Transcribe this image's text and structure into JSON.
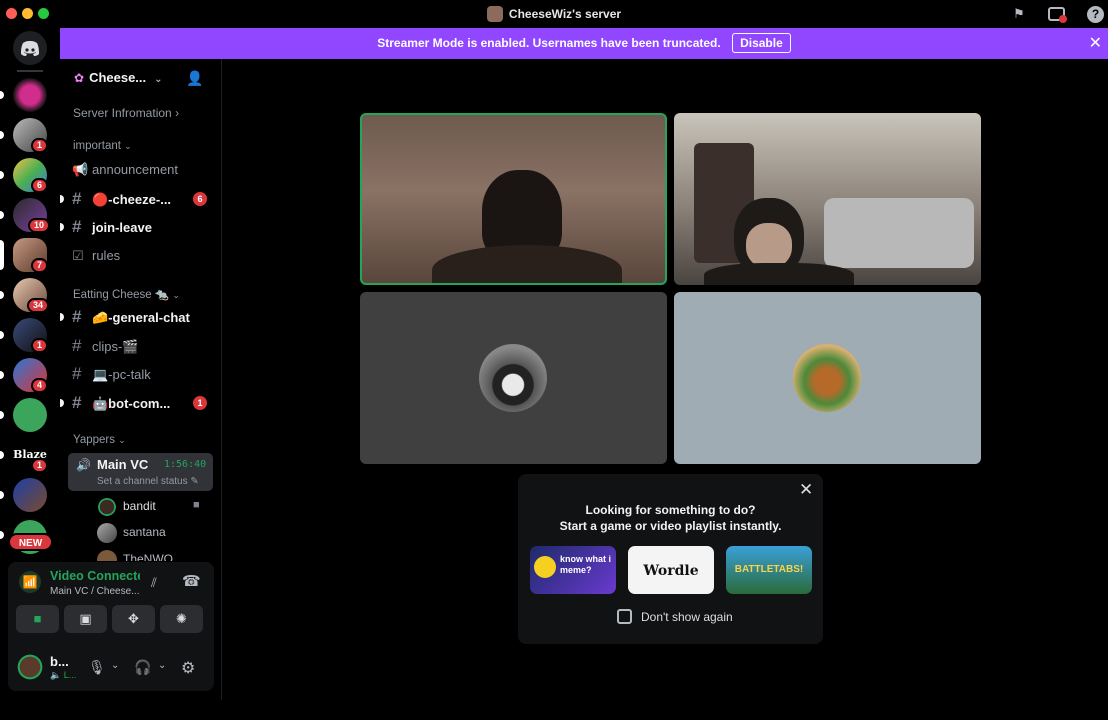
{
  "window": {
    "title": "CheeseWiz's server"
  },
  "banner": {
    "message": "Streamer Mode is enabled. Usernames have been truncated.",
    "disable_label": "Disable"
  },
  "rail": {
    "badges": [
      "1",
      "6",
      "10",
      "7",
      "34",
      "1",
      "4",
      "1"
    ],
    "new_label": "NEW",
    "blaze_label": "Blaze"
  },
  "server": {
    "name": "Cheese...",
    "info_label": "Server Infromation"
  },
  "categories": {
    "important": "important",
    "eating": "Eatting Cheese 🐀",
    "yappers": "Yappers"
  },
  "channels": {
    "announcement": "announcement",
    "cheeze": "🔴-cheeze-...",
    "cheeze_badge": "6",
    "join_leave": "join-leave",
    "rules": "rules",
    "general": "🧀-general-chat",
    "clips": "clips-🎬",
    "pc_talk": "💻-pc-talk",
    "bot": "🤖bot-com...",
    "bot_badge": "1"
  },
  "voice_channel": {
    "name": "Main VC",
    "timer": "1:56:40",
    "status_placeholder": "Set a channel status"
  },
  "voice_members": [
    "bandit",
    "santana",
    "TheNWO..."
  ],
  "voice_panel": {
    "status": "Video Connected",
    "location": "Main VC / Cheese..."
  },
  "user": {
    "name": "b...",
    "status": "L..."
  },
  "activity_popup": {
    "line1": "Looking for something to do?",
    "line2": "Start a game or video playlist instantly.",
    "dont_show": "Don't show again",
    "cards": [
      "know what i meme?",
      "Wordle",
      "BATTLETABS!"
    ]
  },
  "colors": {
    "accent": "#9147ff",
    "speaking": "#23a55a",
    "badge": "#da373c",
    "streamer": "#9147ff"
  }
}
